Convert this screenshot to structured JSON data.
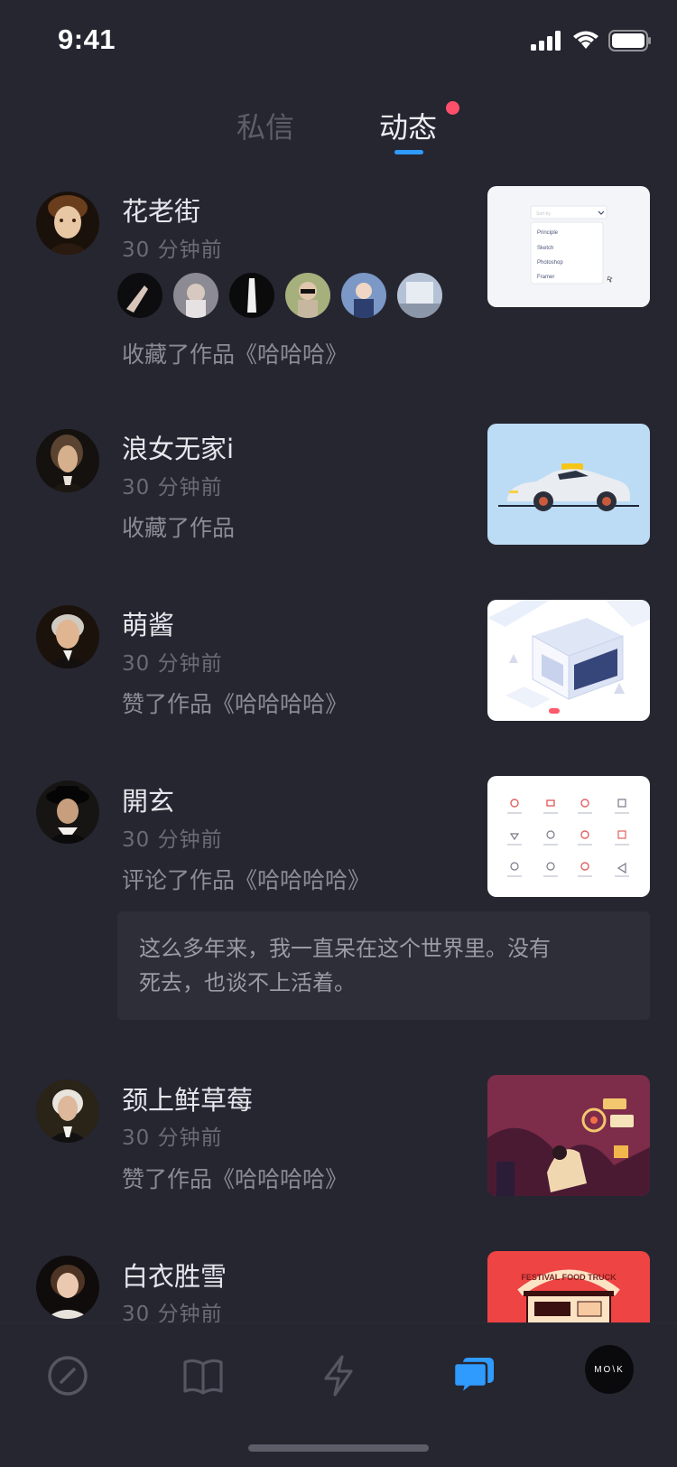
{
  "status_bar": {
    "time": "9:41",
    "icons": [
      "signal-icon",
      "wifi-icon",
      "battery-icon"
    ]
  },
  "tabs": {
    "items": [
      {
        "label": "私信",
        "active": false
      },
      {
        "label": "动态",
        "active": true,
        "has_dot": true
      }
    ],
    "accent_color": "#2f9bff",
    "dot_color": "#ff4f6b"
  },
  "feed": [
    {
      "username": "花老街",
      "time": "30 分钟前",
      "action": "收藏了作品《哈哈哈》",
      "mini_avatars_count": 6,
      "thumb": "dropdown-ui-thumbnail",
      "thumb_text": [
        "Principle",
        "Sketch",
        "Photoshop",
        "Framer"
      ]
    },
    {
      "username": "浪女无家i",
      "time": "30 分钟前",
      "action": "收藏了作品",
      "thumb": "car-thumbnail"
    },
    {
      "username": "萌酱",
      "time": "30 分钟前",
      "action": "赞了作品《哈哈哈哈》",
      "thumb": "isometric-building-thumbnail"
    },
    {
      "username": "開玄",
      "time": "30 分钟前",
      "action": "评论了作品《哈哈哈哈》",
      "comment": "这么多年来，我一直呆在这个世界里。没有死去，也谈不上活着。",
      "thumb": "icon-grid-thumbnail"
    },
    {
      "username": "颈上鲜草莓",
      "time": "30 分钟前",
      "action": "赞了作品《哈哈哈哈》",
      "thumb": "illustration-thumbnail"
    },
    {
      "username": "白衣胜雪",
      "time": "30 分钟前",
      "thumb": "food-truck-thumbnail",
      "thumb_text": "FESTIVAL FOOD TRUCK"
    }
  ],
  "tab_bar": {
    "items": [
      "compass-icon",
      "book-icon",
      "lightning-icon",
      "chat-icon",
      "profile-avatar"
    ],
    "active": "chat-icon",
    "profile_label": "MO\\K"
  }
}
